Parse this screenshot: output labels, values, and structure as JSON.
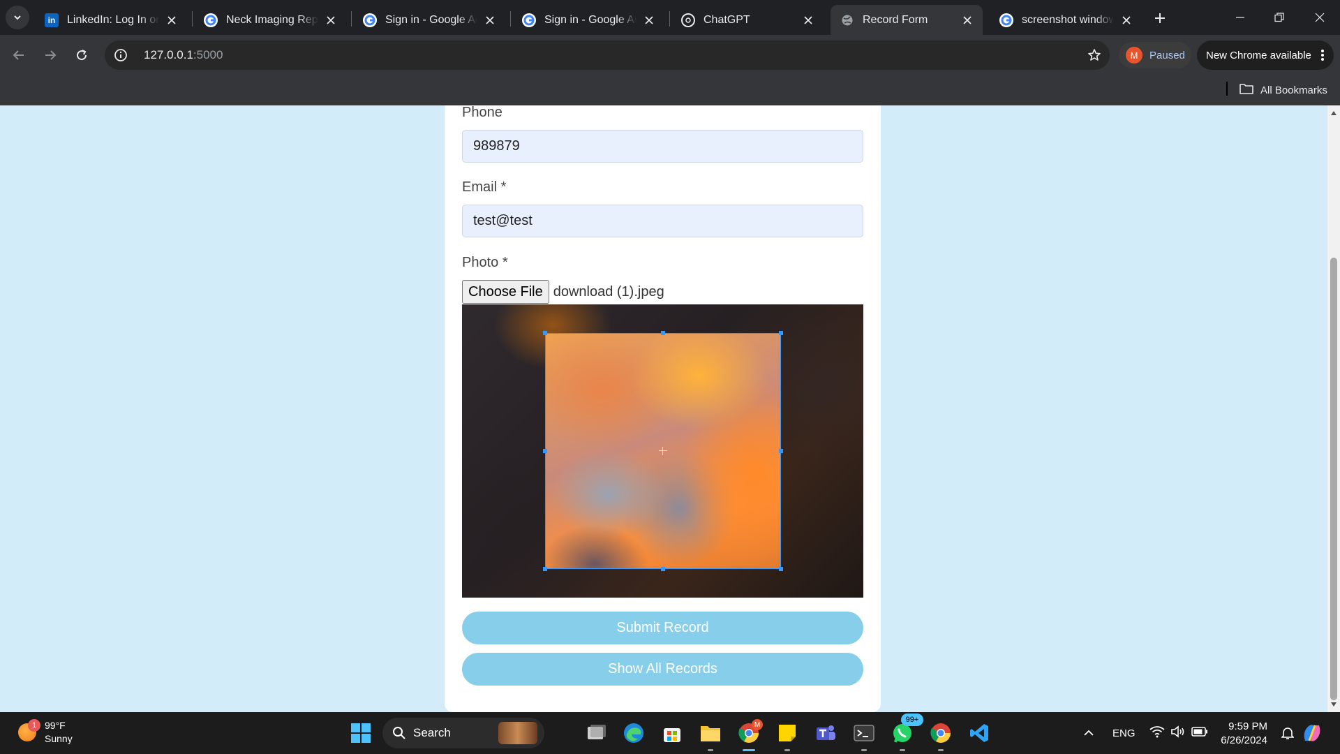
{
  "browser": {
    "tabs": [
      {
        "title": "LinkedIn: Log In or Sign Up",
        "icon": "linkedin-icon",
        "active": false
      },
      {
        "title": "Neck Imaging Report",
        "icon": "google-icon",
        "active": false
      },
      {
        "title": "Sign in - Google Accounts",
        "icon": "google-icon",
        "active": false
      },
      {
        "title": "Sign in - Google Accounts",
        "icon": "google-icon",
        "active": false
      },
      {
        "title": "ChatGPT",
        "icon": "chatgpt-icon",
        "active": false
      },
      {
        "title": "Record Form",
        "icon": "globe-icon",
        "active": true
      },
      {
        "title": "screenshot windows",
        "icon": "google-icon",
        "active": false
      }
    ],
    "address": {
      "host": "127.0.0.1",
      "port": ":5000"
    },
    "profile": {
      "initial": "M",
      "status": "Paused"
    },
    "update_label": "New Chrome available",
    "bookmarks_label": "All Bookmarks"
  },
  "form": {
    "phone": {
      "label": "Phone",
      "value": "989879"
    },
    "email": {
      "label": "Email *",
      "value": "test@test"
    },
    "photo": {
      "label": "Photo *",
      "choose_label": "Choose File",
      "filename": "download (1).jpeg"
    },
    "submit_label": "Submit Record",
    "show_all_label": "Show All Records"
  },
  "taskbar": {
    "weather": {
      "temp": "99°F",
      "condition": "Sunny",
      "badge": "1"
    },
    "search_label": "Search",
    "whatsapp_badge": "99+",
    "chrome_badge": "M",
    "language": "ENG",
    "time": "9:59 PM",
    "date": "6/26/2024"
  },
  "colors": {
    "page_background": "#d2ecf9",
    "button_background": "#87ceeb",
    "input_background": "#e8f0fe",
    "crop_outline": "#3399ff"
  }
}
